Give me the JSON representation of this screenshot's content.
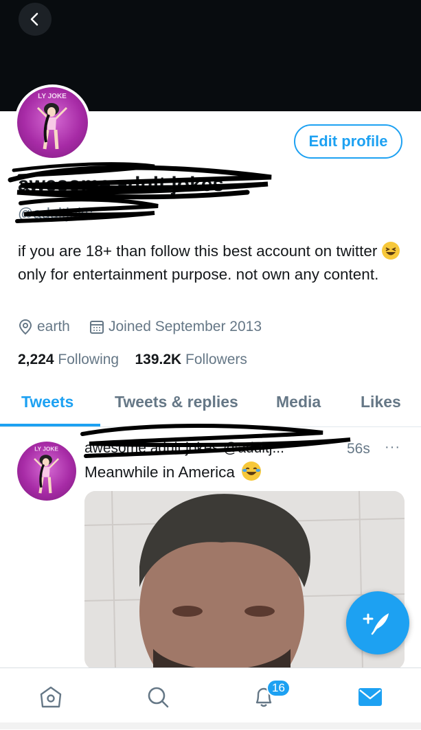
{
  "profile": {
    "name": "awesome adult jokes",
    "handle": "@adultjoks",
    "edit_label": "Edit profile",
    "bio_part1": "if you are 18+ than follow this best account on twitter",
    "bio_part2": " only for entertainment purpose. not own any content.",
    "bio_emoji": "grinning-squinting-face-icon",
    "location": "earth",
    "joined": "Joined September 2013",
    "following_count": "2,224",
    "following_label": "Following",
    "followers_count": "139.2K",
    "followers_label": "Followers"
  },
  "tabs": [
    {
      "label": "Tweets",
      "active": true
    },
    {
      "label": "Tweets & replies",
      "active": false
    },
    {
      "label": "Media",
      "active": false
    },
    {
      "label": "Likes",
      "active": false
    }
  ],
  "tweet": {
    "author": "awesome adult jokes @adultj...",
    "time": "56s",
    "more": "···",
    "text": "Meanwhile in America",
    "emoji": "face-with-tears-of-joy-icon"
  },
  "bottom_nav": {
    "notifications_badge": "16",
    "icons": [
      "home-icon",
      "search-icon",
      "notifications-icon",
      "messages-icon"
    ]
  },
  "colors": {
    "accent": "#1da1f2",
    "text": "#14171a",
    "secondary": "#657786",
    "banner": "#080c0f"
  }
}
